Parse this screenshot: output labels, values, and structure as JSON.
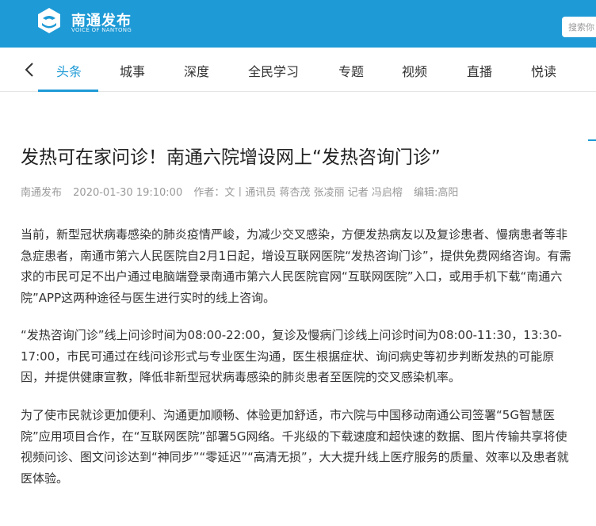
{
  "header": {
    "logo_name": "南通发布",
    "logo_sub": "VOICE OF NANTONG",
    "search_placeholder": "搜索你"
  },
  "nav": {
    "items": [
      {
        "label": "头条",
        "active": true
      },
      {
        "label": "城事"
      },
      {
        "label": "深度"
      },
      {
        "label": "全民学习"
      },
      {
        "label": "专题"
      },
      {
        "label": "视频"
      },
      {
        "label": "直播"
      },
      {
        "label": "悦读"
      }
    ]
  },
  "article": {
    "title": "发热可在家问诊！南通六院增设网上“发热咨询门诊”",
    "source": "南通发布",
    "datetime": "2020-01-30 19:10:00",
    "author": "作者：文丨通讯员 蒋杏茂 张凌丽 记者 冯启榕",
    "editor": "编辑:高阳",
    "paragraphs": [
      "当前，新型冠状病毒感染的肺炎疫情严峻，为减少交叉感染，方便发热病友以及复诊患者、慢病患者等非急症患者，南通市第六人民医院自2月1日起，增设互联网医院“发热咨询门诊”，提供免费网络咨询。有需求的市民可足不出户通过电脑端登录南通市第六人民医院官网“互联网医院”入口，或用手机下载“南通六院”APP这两种途径与医生进行实时的线上咨询。",
      "“发热咨询门诊”线上问诊时间为08:00-22:00，复诊及慢病门诊线上问诊时间为08:00-11:30，13:30-17:00，市民可通过在线问诊形式与专业医生沟通，医生根据症状、询问病史等初步判断发热的可能原因，并提供健康宣教，降低非新型冠状病毒感染的肺炎患者至医院的交叉感染机率。",
      "为了使市民就诊更加便利、沟通更加顺畅、体验更加舒适，市六院与中国移动南通公司签署“5G智慧医院”应用项目合作，在“互联网医院”部署5G网络。千兆级的下载速度和超快速的数据、图片传输共享将使视频问诊、图文问诊达到“神同步”“零延迟”“高清无损”，大大提升线上医疗服务的质量、效率以及患者就医体验。"
    ]
  }
}
